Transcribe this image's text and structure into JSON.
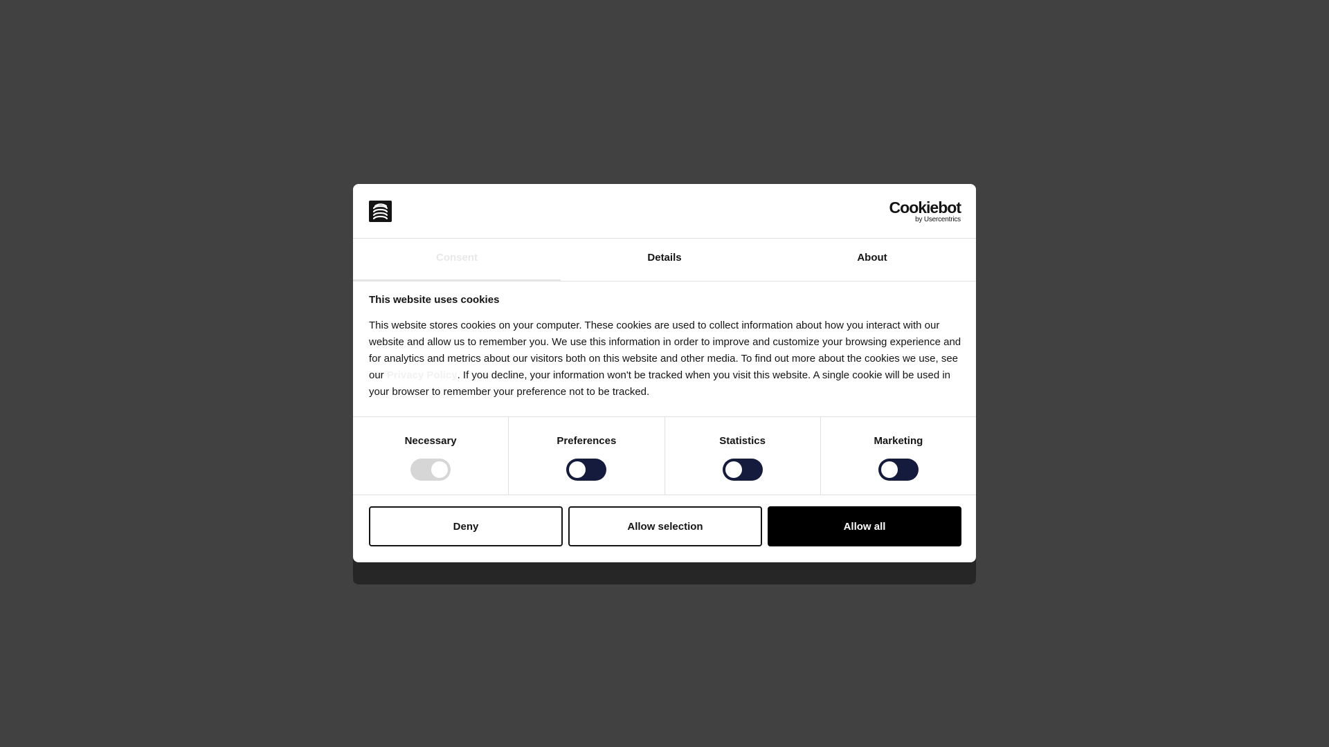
{
  "header": {
    "brand_word": "Cookiebot",
    "brand_sub": "by Usercentrics"
  },
  "tabs": [
    {
      "label": "Consent",
      "active": true
    },
    {
      "label": "Details",
      "active": false
    },
    {
      "label": "About",
      "active": false
    }
  ],
  "content": {
    "title": "This website uses cookies",
    "body_before_link": "This website stores cookies on your computer. These cookies are used to collect information about how you interact with our website and allow us to remember you. We use this information in order to improve and customize your browsing experience and for analytics and metrics about our visitors both on this website and other media. To find out more about the cookies we use, see our ",
    "link_text": "Privacy Policy",
    "body_after_link": ". If you decline, your information won't be tracked when you visit this website. A single cookie will be used in your browser to remember your preference not to be tracked."
  },
  "toggles": [
    {
      "label": "Necessary",
      "enabled": true,
      "disabled": true
    },
    {
      "label": "Preferences",
      "enabled": false,
      "disabled": false
    },
    {
      "label": "Statistics",
      "enabled": false,
      "disabled": false
    },
    {
      "label": "Marketing",
      "enabled": false,
      "disabled": false
    }
  ],
  "buttons": {
    "deny": "Deny",
    "allow_selection": "Allow selection",
    "allow_all": "Allow all"
  },
  "colors": {
    "backdrop": "#414141",
    "toggle_on": "#141b3c",
    "toggle_disabled": "#d6d6d6",
    "primary_button": "#000000"
  }
}
